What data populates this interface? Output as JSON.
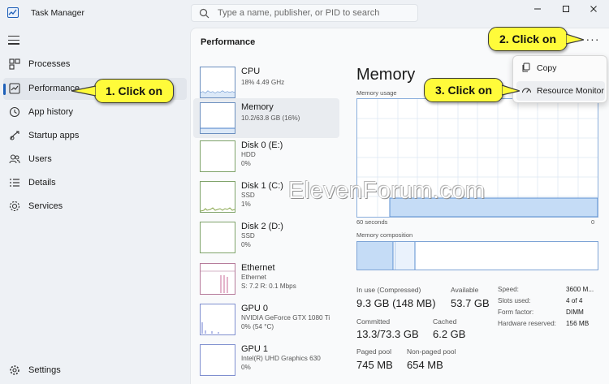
{
  "window": {
    "title": "Task Manager",
    "search_placeholder": "Type a name, publisher, or PID to search"
  },
  "sidebar": {
    "items": [
      {
        "label": "Processes",
        "icon": "processes-icon"
      },
      {
        "label": "Performance",
        "icon": "performance-icon"
      },
      {
        "label": "App history",
        "icon": "history-icon"
      },
      {
        "label": "Startup apps",
        "icon": "startup-icon"
      },
      {
        "label": "Users",
        "icon": "users-icon"
      },
      {
        "label": "Details",
        "icon": "details-icon"
      },
      {
        "label": "Services",
        "icon": "services-icon"
      }
    ],
    "settings_label": "Settings"
  },
  "content": {
    "title": "Performance",
    "more_label": "···"
  },
  "resources": [
    {
      "name": "CPU",
      "sub1": "18% 4.49 GHz",
      "sub2": ""
    },
    {
      "name": "Memory",
      "sub1": "10.2/63.8 GB (16%)",
      "sub2": ""
    },
    {
      "name": "Disk 0 (E:)",
      "sub1": "HDD",
      "sub2": "0%"
    },
    {
      "name": "Disk 1 (C:)",
      "sub1": "SSD",
      "sub2": "1%"
    },
    {
      "name": "Disk 2 (D:)",
      "sub1": "SSD",
      "sub2": "0%"
    },
    {
      "name": "Ethernet",
      "sub1": "Ethernet",
      "sub2": "S: 7.2 R: 0.1 Mbps"
    },
    {
      "name": "GPU 0",
      "sub1": "NVIDIA GeForce GTX 1080 Ti",
      "sub2": "0% (54 °C)"
    },
    {
      "name": "GPU 1",
      "sub1": "Intel(R) UHD Graphics 630",
      "sub2": "0%"
    }
  ],
  "memory": {
    "title": "Memory",
    "usage_label": "Memory usage",
    "usage_level": 0.16,
    "axis_left": "60 seconds",
    "axis_right": "0",
    "composition_label": "Memory composition",
    "stats": {
      "in_use_label": "In use (Compressed)",
      "in_use_value": "9.3 GB (148 MB)",
      "available_label": "Available",
      "available_value": "53.7 GB",
      "committed_label": "Committed",
      "committed_value": "13.3/73.3 GB",
      "cached_label": "Cached",
      "cached_value": "6.2 GB",
      "paged_label": "Paged pool",
      "paged_value": "745 MB",
      "nonpaged_label": "Non-paged pool",
      "nonpaged_value": "654 MB"
    },
    "specs": [
      {
        "label": "Speed:",
        "value": "3600 M..."
      },
      {
        "label": "Slots used:",
        "value": "4 of 4"
      },
      {
        "label": "Form factor:",
        "value": "DIMM"
      },
      {
        "label": "Hardware reserved:",
        "value": "156 MB"
      }
    ]
  },
  "menu": {
    "items": [
      {
        "label": "Copy",
        "icon": "copy-icon"
      },
      {
        "label": "Resource Monitor",
        "icon": "resource-monitor-icon"
      }
    ]
  },
  "callouts": {
    "one": "1. Click on",
    "two": "2. Click on",
    "three": "3. Click on"
  },
  "watermark": "ElevenForum.com",
  "colors": {
    "accent": "#1d5fb8",
    "callout": "#fffb3a",
    "graph_fill": "#c5dcf6"
  }
}
